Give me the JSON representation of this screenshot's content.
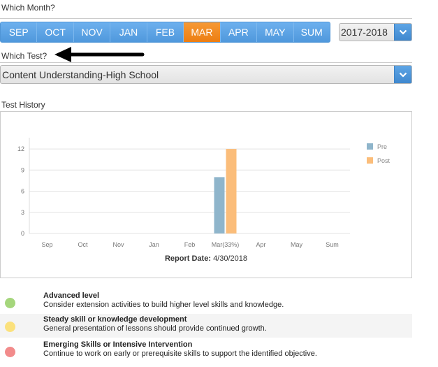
{
  "labels": {
    "which_month": "Which Month?",
    "which_test": "Which Test?",
    "test_history": "Test History"
  },
  "months": [
    {
      "label": "SEP",
      "active": false
    },
    {
      "label": "OCT",
      "active": false
    },
    {
      "label": "NOV",
      "active": false
    },
    {
      "label": "JAN",
      "active": false
    },
    {
      "label": "FEB",
      "active": false
    },
    {
      "label": "MAR",
      "active": true
    },
    {
      "label": "APR",
      "active": false
    },
    {
      "label": "MAY",
      "active": false
    },
    {
      "label": "SUM",
      "active": false
    }
  ],
  "year_select": {
    "value": "2017-2018"
  },
  "test_select": {
    "value": "Content Understanding-High School"
  },
  "colors": {
    "accent": "#5ea5e5",
    "active_month": "#f08a24",
    "pre": "#8fb5cb",
    "post": "#fbbd7a"
  },
  "chart_data": {
    "type": "bar",
    "categories": [
      "Sep",
      "Oct",
      "Nov",
      "Jan",
      "Feb",
      "Mar(33%)",
      "Apr",
      "May",
      "Sum"
    ],
    "series": [
      {
        "name": "Pre",
        "values": [
          null,
          null,
          null,
          null,
          null,
          8,
          null,
          null,
          null
        ]
      },
      {
        "name": "Post",
        "values": [
          null,
          null,
          null,
          null,
          null,
          12,
          null,
          null,
          null
        ]
      }
    ],
    "yticks": [
      0,
      3,
      6,
      9,
      12
    ],
    "ylim": [
      0,
      13
    ],
    "grid": true,
    "legend_position": "top-right",
    "footer_label": "Report Date:",
    "footer_value": "4/30/2018"
  },
  "key": [
    {
      "title": "Advanced level",
      "desc": "Consider extension activities to build higher level skills and knowledge.",
      "color": "#a5d67c"
    },
    {
      "title": "Steady skill or knowledge development",
      "desc": "General presentation of lessons should provide continued growth.",
      "color": "#fbe17c"
    },
    {
      "title": "Emerging Skills or Intensive Intervention",
      "desc": "Continue to work on early or prerequisite skills to support the identified objective.",
      "color": "#f28b8b"
    }
  ]
}
